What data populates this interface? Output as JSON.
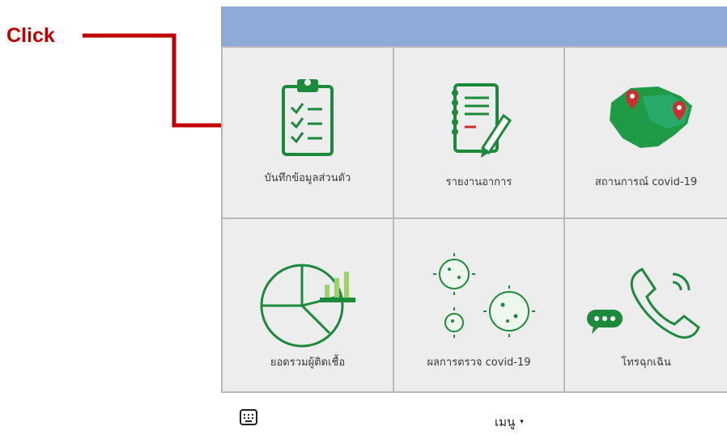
{
  "annotation": {
    "label": "Click"
  },
  "menu": {
    "items": [
      {
        "label": "บันทึกข้อมูลส่วนตัว",
        "icon": "clipboard-checklist-icon"
      },
      {
        "label": "รายงานอาการ",
        "icon": "notebook-pen-icon"
      },
      {
        "label": "สถานการณ์ covid-19",
        "icon": "map-pin-icon"
      },
      {
        "label": "ยอดรวมผู้ติดเชื้อ",
        "icon": "pie-chart-icon"
      },
      {
        "label": "ผลการตรวจ covid-19",
        "icon": "virus-icon"
      },
      {
        "label": "โทรฉุกเฉิน",
        "icon": "phone-icon"
      }
    ]
  },
  "footer": {
    "menu_label": "เมนู",
    "caret": "▾",
    "keyboard_icon": "keyboard-icon"
  },
  "colors": {
    "header": "#8eabd8",
    "icon_green": "#1b8a3a",
    "annotation_red": "#c00000"
  }
}
